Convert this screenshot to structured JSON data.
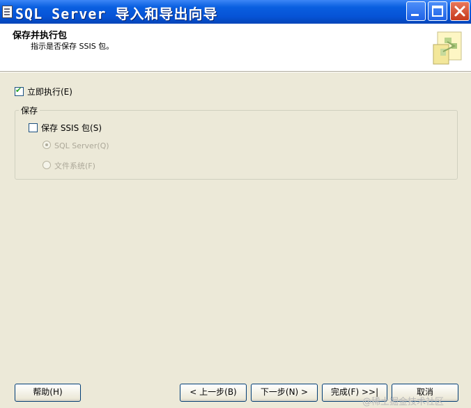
{
  "window": {
    "title": "SQL Server 导入和导出向导",
    "controls": [
      "minimize",
      "maximize",
      "close"
    ]
  },
  "header": {
    "title": "保存并执行包",
    "subtitle": "指示是否保存 SSIS 包。",
    "logo_icon": "wizard-package-icon"
  },
  "options": {
    "execute_now": {
      "label": "立即执行(E)",
      "checked": true
    },
    "save_group_title": "保存",
    "save_ssis": {
      "label": "保存 SSIS 包(S)",
      "checked": false
    },
    "sql_server": {
      "label": "SQL Server(Q)",
      "selected": true,
      "enabled": false
    },
    "file_system": {
      "label": "文件系统(F)",
      "selected": false,
      "enabled": false
    }
  },
  "footer": {
    "help": "帮助(H)",
    "back": "< 上一步(B)",
    "next": "下一步(N) >",
    "finish": "完成(F) >>|",
    "cancel": "取消"
  },
  "watermark": "@稀土掘金技术社区"
}
